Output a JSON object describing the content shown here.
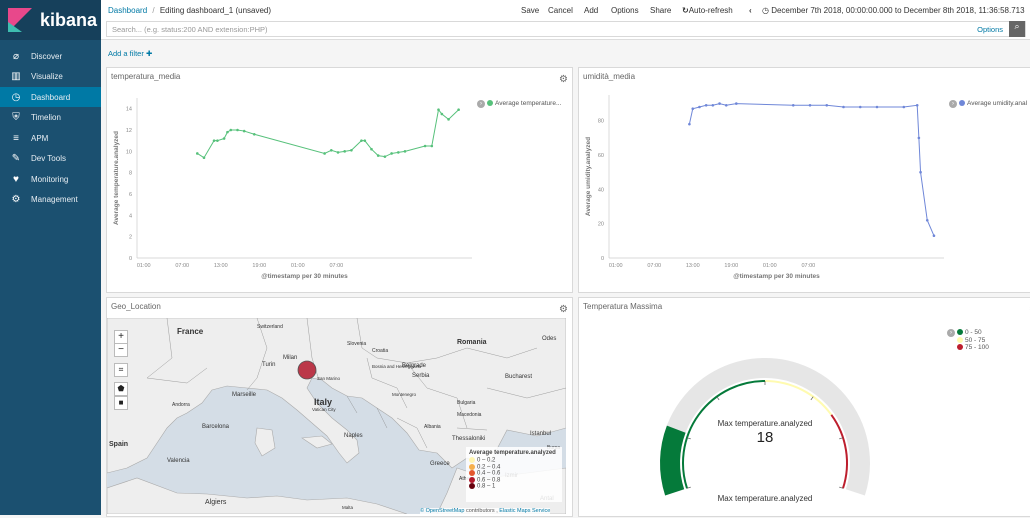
{
  "app": {
    "name": "kibana"
  },
  "sidebar": {
    "items": [
      {
        "label": "Discover",
        "icon": "compass-icon",
        "glyph": "⌀"
      },
      {
        "label": "Visualize",
        "icon": "bar-chart-icon",
        "glyph": "▥"
      },
      {
        "label": "Dashboard",
        "icon": "dashboard-icon",
        "glyph": "◷",
        "active": true
      },
      {
        "label": "Timelion",
        "icon": "timelion-icon",
        "glyph": "⛨"
      },
      {
        "label": "APM",
        "icon": "apm-icon",
        "glyph": "≡"
      },
      {
        "label": "Dev Tools",
        "icon": "wrench-icon",
        "glyph": "✎"
      },
      {
        "label": "Monitoring",
        "icon": "heartbeat-icon",
        "glyph": "♥"
      },
      {
        "label": "Management",
        "icon": "gear-icon",
        "glyph": "⚙"
      }
    ]
  },
  "header": {
    "breadcrumb_root": "Dashboard",
    "breadcrumb_sep": "/",
    "breadcrumb_current": "Editing dashboard_1 (unsaved)",
    "actions": {
      "save": "Save",
      "cancel": "Cancel",
      "add": "Add",
      "options": "Options",
      "share": "Share",
      "auto_refresh": "Auto-refresh"
    },
    "time_range": "December 7th 2018, 00:00:00.000 to December 8th 2018, 11:36:58.713",
    "search_placeholder": "Search... (e.g. status:200 AND extension:PHP)",
    "search_options": "Options",
    "add_filter": "Add a filter"
  },
  "panels": {
    "temp": {
      "title": "temperatura_media",
      "legend": "Average temperature...",
      "ylabel": "Average temperature.analyzed",
      "xlabel": "@timestamp per 30 minutes",
      "yticks": [
        "0",
        "2",
        "4",
        "6",
        "8",
        "10",
        "12",
        "14"
      ],
      "xticks": [
        "01:00",
        "07:00",
        "13:00",
        "19:00",
        "01:00",
        "07:00"
      ],
      "color": "#57c17b"
    },
    "humid": {
      "title": "umidità_media",
      "legend": "Average umidity.anal",
      "ylabel": "Average umidity.analyzed",
      "xlabel": "@timestamp per 30 minutes",
      "yticks": [
        "0",
        "20",
        "40",
        "60",
        "80"
      ],
      "xticks": [
        "01:00",
        "07:00",
        "13:00",
        "19:00",
        "01:00",
        "07:00"
      ],
      "color": "#6f87d8"
    },
    "geo": {
      "title": "Geo_Location",
      "labels": [
        "France",
        "Switzerland",
        "Milan",
        "Turin",
        "San Marino",
        "Slovenia",
        "Croatia",
        "Bosnia and Herzegovina",
        "Serbia",
        "Belgrade",
        "Bucharest",
        "Romania",
        "Montenegro",
        "Bulgaria",
        "Andorra",
        "Marseille",
        "Italy",
        "Vatican City",
        "Barcelona",
        "Naples",
        "Albania",
        "Macedonia",
        "Thessaloniki",
        "Istanbul",
        "Spain",
        "Valencia",
        "Greece",
        "Bursa",
        "Athens",
        "Izmir",
        "Algiers",
        "Antal",
        "Malta",
        "Odes"
      ],
      "legend_title": "Average temperature.analyzed",
      "legend_items": [
        "0 – 0.2",
        "0.2 – 0.4",
        "0.4 – 0.6",
        "0.6 – 0.8",
        "0.8 – 1"
      ],
      "legend_colors": [
        "#fff5b0",
        "#f6b04d",
        "#e4572e",
        "#b2182b",
        "#67000d"
      ],
      "attribution_link1": "© OpenStreetMap",
      "attribution_mid": " contributors , ",
      "attribution_link2": "Elastic Maps Service"
    },
    "gauge": {
      "title": "Temperatura Massima",
      "label": "Max temperature.analyzed",
      "value": "18",
      "bottom_label": "Max temperature.analyzed",
      "ranges": [
        {
          "label": "0 - 50",
          "color": "#057a3a"
        },
        {
          "label": "50 - 75",
          "color": "#fffbb0"
        },
        {
          "label": "75 - 100",
          "color": "#bd1e2d"
        }
      ]
    }
  },
  "chart_data": [
    {
      "type": "line",
      "title": "temperatura_media",
      "xlabel": "@timestamp per 30 minutes",
      "ylabel": "Average temperature.analyzed",
      "ylim": [
        0,
        15
      ],
      "xticks": [
        "01:00",
        "07:00",
        "13:00",
        "19:00",
        "01:00",
        "07:00"
      ],
      "series": [
        {
          "name": "Average temperature...",
          "x": [
            0.18,
            0.2,
            0.23,
            0.24,
            0.26,
            0.27,
            0.28,
            0.3,
            0.32,
            0.35,
            0.56,
            0.58,
            0.6,
            0.62,
            0.64,
            0.67,
            0.68,
            0.7,
            0.72,
            0.74,
            0.76,
            0.78,
            0.8,
            0.86,
            0.88,
            0.9,
            0.91,
            0.93,
            0.96
          ],
          "values": [
            9.8,
            9.4,
            11.0,
            11.0,
            11.2,
            11.8,
            12.0,
            12.0,
            11.9,
            11.6,
            9.8,
            10.1,
            9.9,
            10.0,
            10.1,
            11.0,
            11.0,
            10.2,
            9.6,
            9.5,
            9.8,
            9.9,
            10.0,
            10.5,
            10.5,
            13.9,
            13.5,
            13.0,
            13.9
          ]
        }
      ]
    },
    {
      "type": "line",
      "title": "umidità_media",
      "xlabel": "@timestamp per 30 minutes",
      "ylabel": "Average umidity.analyzed",
      "ylim": [
        0,
        95
      ],
      "xticks": [
        "01:00",
        "07:00",
        "13:00",
        "19:00",
        "01:00",
        "07:00"
      ],
      "series": [
        {
          "name": "Average umidity.anal",
          "x": [
            0.24,
            0.25,
            0.27,
            0.29,
            0.31,
            0.33,
            0.35,
            0.38,
            0.55,
            0.6,
            0.65,
            0.7,
            0.75,
            0.8,
            0.88,
            0.92,
            0.925,
            0.93,
            0.95,
            0.97
          ],
          "values": [
            78,
            87,
            88,
            89,
            89,
            90,
            89,
            90,
            89,
            89,
            89,
            88,
            88,
            88,
            88,
            89,
            70,
            50,
            22,
            13
          ]
        }
      ]
    }
  ]
}
